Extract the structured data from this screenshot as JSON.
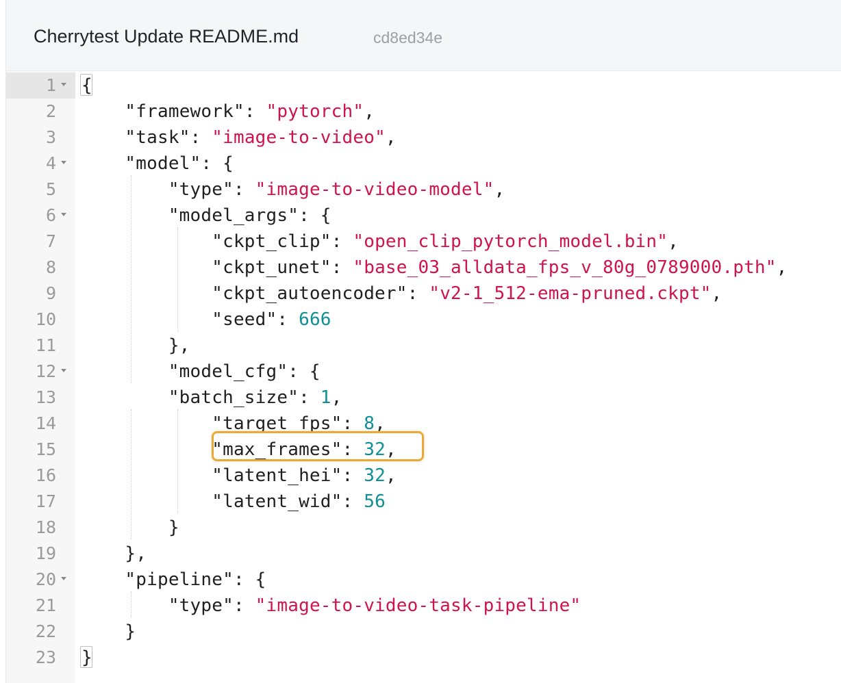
{
  "header": {
    "commit_title": "Cherrytest Update README.md",
    "commit_hash": "cd8ed34e"
  },
  "editor": {
    "lines": [
      {
        "num": "1",
        "fold": true,
        "active": true,
        "tokens": [
          {
            "t": "p",
            "v": "{"
          }
        ]
      },
      {
        "num": "2",
        "tokens": [
          {
            "t": "p",
            "v": "    "
          },
          {
            "t": "k",
            "v": "\"framework\""
          },
          {
            "t": "p",
            "v": ": "
          },
          {
            "t": "s",
            "v": "\"pytorch\""
          },
          {
            "t": "p",
            "v": ","
          }
        ]
      },
      {
        "num": "3",
        "tokens": [
          {
            "t": "p",
            "v": "    "
          },
          {
            "t": "k",
            "v": "\"task\""
          },
          {
            "t": "p",
            "v": ": "
          },
          {
            "t": "s",
            "v": "\"image-to-video\""
          },
          {
            "t": "p",
            "v": ","
          }
        ]
      },
      {
        "num": "4",
        "fold": true,
        "tokens": [
          {
            "t": "p",
            "v": "    "
          },
          {
            "t": "k",
            "v": "\"model\""
          },
          {
            "t": "p",
            "v": ": {"
          }
        ]
      },
      {
        "num": "5",
        "tokens": [
          {
            "t": "p",
            "v": "        "
          },
          {
            "t": "k",
            "v": "\"type\""
          },
          {
            "t": "p",
            "v": ": "
          },
          {
            "t": "s",
            "v": "\"image-to-video-model\""
          },
          {
            "t": "p",
            "v": ","
          }
        ]
      },
      {
        "num": "6",
        "fold": true,
        "tokens": [
          {
            "t": "p",
            "v": "        "
          },
          {
            "t": "k",
            "v": "\"model_args\""
          },
          {
            "t": "p",
            "v": ": {"
          }
        ]
      },
      {
        "num": "7",
        "tokens": [
          {
            "t": "p",
            "v": "            "
          },
          {
            "t": "k",
            "v": "\"ckpt_clip\""
          },
          {
            "t": "p",
            "v": ": "
          },
          {
            "t": "s",
            "v": "\"open_clip_pytorch_model.bin\""
          },
          {
            "t": "p",
            "v": ","
          }
        ]
      },
      {
        "num": "8",
        "tokens": [
          {
            "t": "p",
            "v": "            "
          },
          {
            "t": "k",
            "v": "\"ckpt_unet\""
          },
          {
            "t": "p",
            "v": ": "
          },
          {
            "t": "s",
            "v": "\"base_03_alldata_fps_v_80g_0789000.pth\""
          },
          {
            "t": "p",
            "v": ","
          }
        ]
      },
      {
        "num": "9",
        "tokens": [
          {
            "t": "p",
            "v": "            "
          },
          {
            "t": "k",
            "v": "\"ckpt_autoencoder\""
          },
          {
            "t": "p",
            "v": ": "
          },
          {
            "t": "s",
            "v": "\"v2-1_512-ema-pruned.ckpt\""
          },
          {
            "t": "p",
            "v": ","
          }
        ]
      },
      {
        "num": "10",
        "tokens": [
          {
            "t": "p",
            "v": "            "
          },
          {
            "t": "k",
            "v": "\"seed\""
          },
          {
            "t": "p",
            "v": ": "
          },
          {
            "t": "n",
            "v": "666"
          }
        ]
      },
      {
        "num": "11",
        "tokens": [
          {
            "t": "p",
            "v": "        },"
          }
        ]
      },
      {
        "num": "12",
        "fold": true,
        "tokens": [
          {
            "t": "p",
            "v": "        "
          },
          {
            "t": "k",
            "v": "\"model_cfg\""
          },
          {
            "t": "p",
            "v": ": {"
          }
        ]
      },
      {
        "num": "13",
        "tokens": [
          {
            "t": "p",
            "v": "        "
          },
          {
            "t": "k",
            "v": "\"batch_size\""
          },
          {
            "t": "p",
            "v": ": "
          },
          {
            "t": "n",
            "v": "1"
          },
          {
            "t": "p",
            "v": ","
          }
        ]
      },
      {
        "num": "14",
        "tokens": [
          {
            "t": "p",
            "v": "            "
          },
          {
            "t": "k",
            "v": "\"target_fps\""
          },
          {
            "t": "p",
            "v": ": "
          },
          {
            "t": "n",
            "v": "8"
          },
          {
            "t": "p",
            "v": ","
          }
        ]
      },
      {
        "num": "15",
        "tokens": [
          {
            "t": "p",
            "v": "            "
          },
          {
            "t": "k",
            "v": "\"max_frames\""
          },
          {
            "t": "p",
            "v": ": "
          },
          {
            "t": "n",
            "v": "32"
          },
          {
            "t": "p",
            "v": ","
          }
        ]
      },
      {
        "num": "16",
        "tokens": [
          {
            "t": "p",
            "v": "            "
          },
          {
            "t": "k",
            "v": "\"latent_hei\""
          },
          {
            "t": "p",
            "v": ": "
          },
          {
            "t": "n",
            "v": "32"
          },
          {
            "t": "p",
            "v": ","
          }
        ]
      },
      {
        "num": "17",
        "tokens": [
          {
            "t": "p",
            "v": "            "
          },
          {
            "t": "k",
            "v": "\"latent_wid\""
          },
          {
            "t": "p",
            "v": ": "
          },
          {
            "t": "n",
            "v": "56"
          }
        ]
      },
      {
        "num": "18",
        "tokens": [
          {
            "t": "p",
            "v": "        }"
          }
        ]
      },
      {
        "num": "19",
        "tokens": [
          {
            "t": "p",
            "v": "    },"
          }
        ]
      },
      {
        "num": "20",
        "fold": true,
        "tokens": [
          {
            "t": "p",
            "v": "    "
          },
          {
            "t": "k",
            "v": "\"pipeline\""
          },
          {
            "t": "p",
            "v": ": {"
          }
        ]
      },
      {
        "num": "21",
        "tokens": [
          {
            "t": "p",
            "v": "        "
          },
          {
            "t": "k",
            "v": "\"type\""
          },
          {
            "t": "p",
            "v": ": "
          },
          {
            "t": "s",
            "v": "\"image-to-video-task-pipeline\""
          }
        ]
      },
      {
        "num": "22",
        "tokens": [
          {
            "t": "p",
            "v": "    }"
          }
        ]
      },
      {
        "num": "23",
        "tokens": [
          {
            "t": "p",
            "v": "}"
          }
        ]
      }
    ],
    "highlighted_line": "15",
    "colors": {
      "string": "#d0134d",
      "number": "#0f8f95",
      "key": "#1f1f1f",
      "highlight_border": "#e8a83a"
    }
  }
}
